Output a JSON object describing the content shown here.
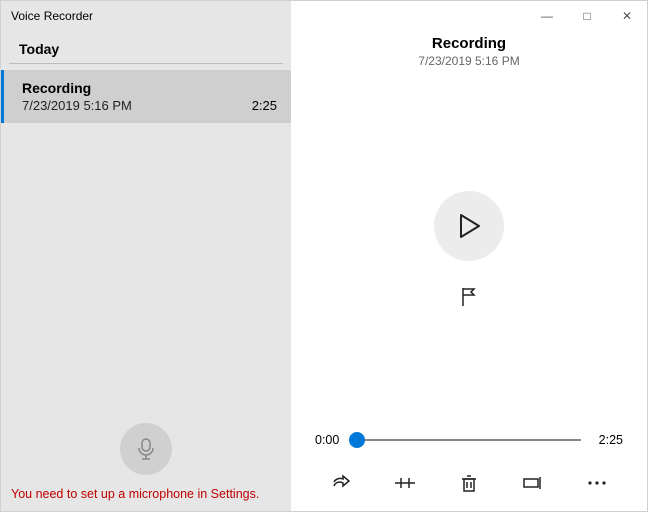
{
  "app_title": "Voice Recorder",
  "window": {
    "minimize": "—",
    "maximize": "□",
    "close": "✕"
  },
  "sidebar": {
    "section_label": "Today",
    "items": [
      {
        "title": "Recording",
        "timestamp": "7/23/2019 5:16 PM",
        "duration": "2:25"
      }
    ],
    "warning": "You need to set up a microphone in Settings."
  },
  "main": {
    "title": "Recording",
    "subtitle": "7/23/2019 5:16 PM",
    "current_time": "0:00",
    "total_time": "2:25"
  }
}
